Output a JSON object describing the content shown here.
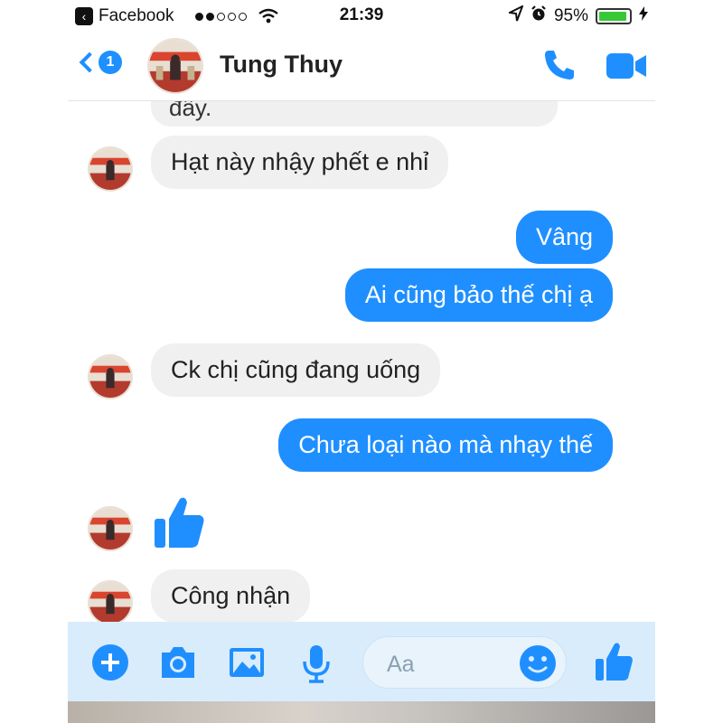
{
  "status_bar": {
    "app_name": "Facebook",
    "time": "21:39",
    "battery": "95%",
    "battery_level": 0.95
  },
  "header": {
    "back_count": "1",
    "contact_name": "Tung Thuy"
  },
  "messages": [
    {
      "side": "incoming",
      "text": "đây.",
      "partial": true
    },
    {
      "side": "incoming",
      "text": "Hạt này nhậy phết e nhỉ"
    },
    {
      "side": "outgoing",
      "text": "Vâng"
    },
    {
      "side": "outgoing",
      "text": "Ai cũng bảo thế chị ạ"
    },
    {
      "side": "incoming",
      "text": "Ck chị cũng đang uống"
    },
    {
      "side": "outgoing",
      "text": "Chưa loại nào mà nhạy thế"
    },
    {
      "side": "incoming",
      "type": "like-sticker"
    },
    {
      "side": "incoming",
      "text": "Công nhận"
    }
  ],
  "composer": {
    "placeholder": "Aa"
  },
  "colors": {
    "messenger_blue": "#1f8fff",
    "incoming_bubble": "#f0f0f0",
    "composer_bg": "#d9ecfb"
  }
}
